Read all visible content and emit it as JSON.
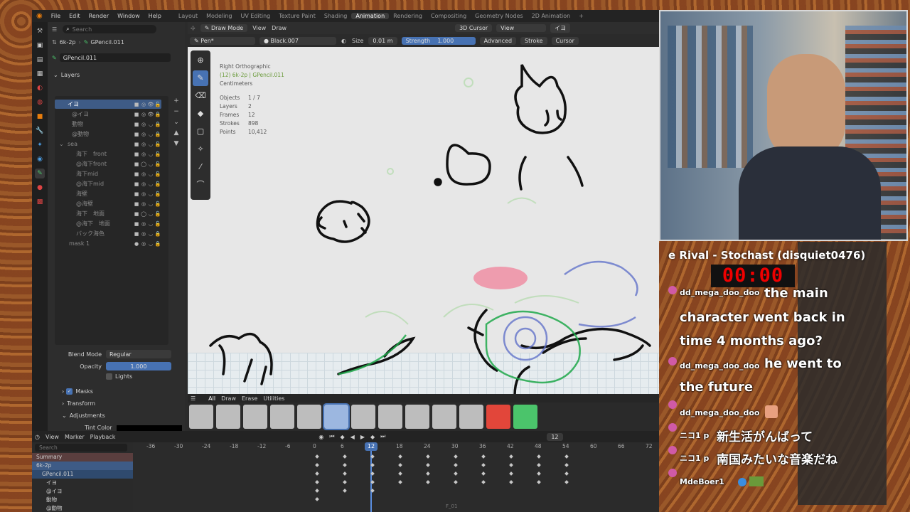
{
  "menu": {
    "items": [
      "File",
      "Edit",
      "Render",
      "Window",
      "Help"
    ],
    "workspaces": [
      "Layout",
      "Modeling",
      "UV Editing",
      "Texture Paint",
      "Shading",
      "Animation",
      "Rendering",
      "Compositing",
      "Geometry Nodes",
      "2D Animation",
      "+"
    ],
    "active_workspace": "Animation"
  },
  "props": {
    "search_placeholder": "Search",
    "object": "6k-2p",
    "data": "GPencil.011",
    "datablock": "GPencil.011",
    "layers_title": "Layers",
    "blend_mode_label": "Blend Mode",
    "blend_mode": "Regular",
    "opacity_label": "Opacity",
    "opacity": "1.000",
    "lights": "Lights",
    "masks": "Masks",
    "transform": "Transform",
    "adjustments": "Adjustments",
    "tint": "Tint Color"
  },
  "layers": [
    {
      "name": "イヨ",
      "sel": true
    },
    {
      "name": "@イヨ"
    },
    {
      "name": "動物"
    },
    {
      "name": "@動物"
    },
    {
      "name": "sea",
      "group": true
    },
    {
      "name": "海下　front"
    },
    {
      "name": "@海下front"
    },
    {
      "name": "海下mid"
    },
    {
      "name": "@海下mid"
    },
    {
      "name": "海壁"
    },
    {
      "name": "@海壁"
    },
    {
      "name": "海下　地面"
    },
    {
      "name": "@海下　地面"
    },
    {
      "name": "バック海色"
    },
    {
      "name": "mask 1"
    }
  ],
  "viewport": {
    "mode": "Draw Mode",
    "view": "View",
    "draw": "Draw",
    "cursor": "3D Cursor",
    "view2": "View",
    "layer": "イヨ",
    "brush": "Pen*",
    "material": "Black.007",
    "size_label": "Size",
    "size": "0.01 m",
    "strength_label": "Strength",
    "strength": "1.000",
    "advanced": "Advanced",
    "stroke": "Stroke",
    "cursor2": "Cursor"
  },
  "vinfo": {
    "view": "Right Orthographic",
    "context": "(12) 6k-2p | GPencil.011",
    "units": "Centimeters",
    "objects": "Objects",
    "objects_v": "1 / 7",
    "layers": "Layers",
    "layers_v": "2",
    "frames": "Frames",
    "frames_v": "12",
    "strokes": "Strokes",
    "strokes_v": "898",
    "points": "Points",
    "points_v": "10,412"
  },
  "brushbar": {
    "tabs": [
      "All",
      "Draw",
      "Erase",
      "Utilities"
    ]
  },
  "timeline": {
    "view": "View",
    "marker": "Marker",
    "playback": "Playback",
    "frame": "12",
    "search": "Search",
    "ticks": [
      "-36",
      "-30",
      "-24",
      "-18",
      "-12",
      "-6",
      "0",
      "6",
      "12",
      "18",
      "24",
      "30",
      "36",
      "42",
      "48",
      "54",
      "60",
      "66",
      "72"
    ],
    "names": [
      "Summary",
      "6k-2p",
      "GPencil.011",
      "イヨ",
      "@イヨ",
      "動物",
      "@動物"
    ],
    "footer": "F_01"
  },
  "overlay": {
    "song": "e Rival - Stochast (disquiet0476)",
    "timer": "00:00"
  },
  "chat": [
    {
      "user": "dd_mega_doo_doo",
      "text": "the main"
    },
    {
      "user": "",
      "text": "character went back in"
    },
    {
      "user": "",
      "text": "time 4 months ago?"
    },
    {
      "user": "dd_mega_doo_doo",
      "text": "he went to"
    },
    {
      "user": "",
      "text": "the future"
    },
    {
      "user": "dd_mega_doo_doo",
      "text": ""
    },
    {
      "user": "ニコ1 p",
      "text": "新生活がんばって"
    },
    {
      "user": "ニコ1 p",
      "text": "南国みたいな音楽だね"
    },
    {
      "user": "MdeBoer1",
      "text": ""
    }
  ],
  "colors": {
    "accent": "#4772b3",
    "blender_orange": "#e87d0d",
    "active_key": "#5a8ee0"
  }
}
